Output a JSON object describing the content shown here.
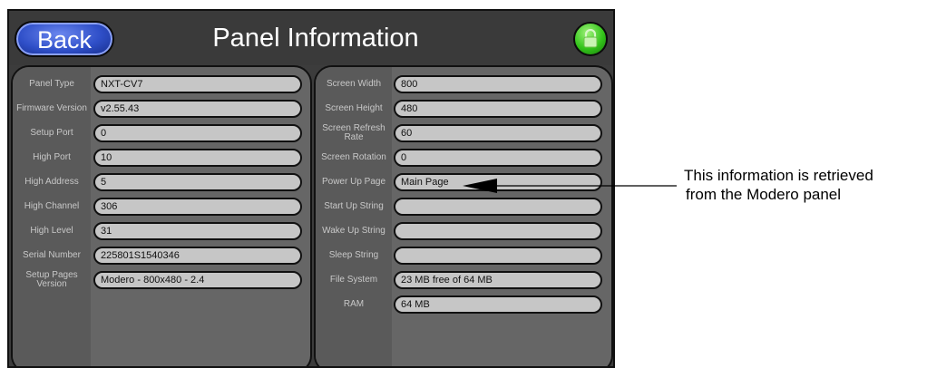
{
  "header": {
    "back_label": "Back",
    "title": "Panel Information",
    "lock_icon": "lock-icon",
    "colors": {
      "back_button": "#2f4fc8",
      "lock_button": "#33c41a",
      "panel_bg": "#3c3c3c",
      "field_bg": "#c6c6c6"
    }
  },
  "left_card": {
    "rows": [
      {
        "label": "Panel Type",
        "value": "NXT-CV7"
      },
      {
        "label": "Firmware Version",
        "value": "v2.55.43"
      },
      {
        "label": "Setup Port",
        "value": "0"
      },
      {
        "label": "High Port",
        "value": "10"
      },
      {
        "label": "High Address",
        "value": "5"
      },
      {
        "label": "High Channel",
        "value": "306"
      },
      {
        "label": "High Level",
        "value": "31"
      },
      {
        "label": "Serial Number",
        "value": "225801S1540346"
      },
      {
        "label": "Setup Pages Version",
        "value": "Modero - 800x480 - 2.4"
      }
    ]
  },
  "right_card": {
    "rows": [
      {
        "label": "Screen Width",
        "value": "800"
      },
      {
        "label": "Screen Height",
        "value": "480"
      },
      {
        "label": "Screen Refresh Rate",
        "value": "60"
      },
      {
        "label": "Screen Rotation",
        "value": "0"
      },
      {
        "label": "Power Up Page",
        "value": "Main Page"
      },
      {
        "label": "Start Up String",
        "value": ""
      },
      {
        "label": "Wake Up String",
        "value": ""
      },
      {
        "label": "Sleep String",
        "value": ""
      },
      {
        "label": "File System",
        "value": "23 MB free of 64 MB"
      },
      {
        "label": "RAM",
        "value": "64 MB"
      }
    ]
  },
  "annotation": {
    "line1": "This information is retrieved",
    "line2": "from the Modero panel"
  }
}
